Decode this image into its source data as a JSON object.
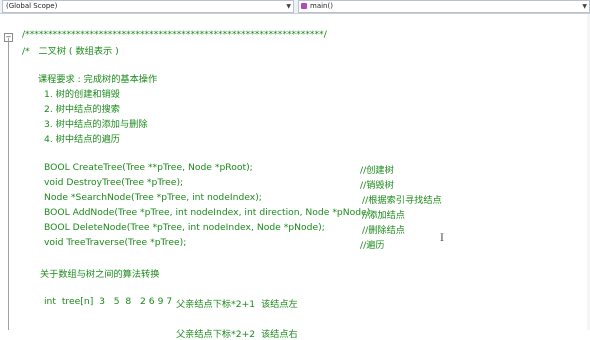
{
  "toolbar": {
    "scope": "(Global Scope)",
    "function": "main()"
  },
  "code": {
    "line1": "/*****************************************************************/",
    "line2": "/*   二叉树 ( 数组表示 )",
    "line3": "课程要求 : 完成树的基本操作",
    "req1": "1. 树的创建和销毁",
    "req2": "2. 树中结点的搜索",
    "req3": "3. 树中结点的添加与删除",
    "req4": "4. 树中结点的遍历",
    "f1": "BOOL CreateTree(Tree **pTree, Node *pRoot);",
    "c1": "//创建树",
    "f2": "void DestroyTree(Tree *pTree);",
    "c2": "//销毁树",
    "f3": "Node *SearchNode(Tree *pTree, int nodeIndex);",
    "c3": "//根据索引寻找结点",
    "f4": "BOOL AddNode(Tree *pTree, int nodeIndex, int direction, Node *pNode);",
    "c4": "//添加结点",
    "f5": "BOOL DeleteNode(Tree *pTree, int nodeIndex, Node *pNode);",
    "c5": "//删除结点",
    "f6": "void TreeTraverse(Tree *pTree);",
    "c6": "//遍历",
    "algo": "关于数组与树之间的算法转换",
    "arr": "int  tree[n]  3   5  8   2 6 9 7",
    "arr_note": "父亲结点下标*2+1  该结点左",
    "partial": "父亲结点下标*2+2  该结点右"
  }
}
